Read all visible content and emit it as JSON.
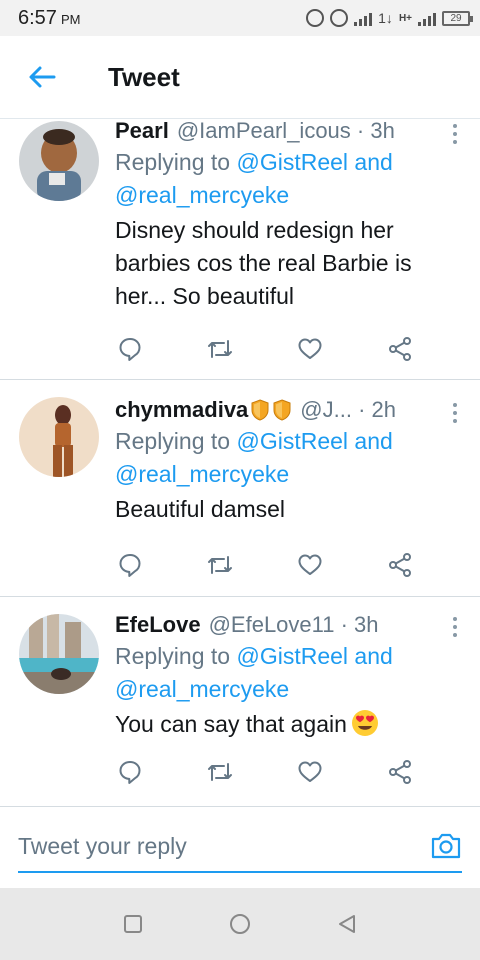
{
  "status_bar": {
    "time": "6:57",
    "ampm": "PM",
    "data_indicator": "1↓",
    "network": "H+",
    "battery": "29"
  },
  "header": {
    "title": "Tweet"
  },
  "tweets": [
    {
      "name": "Pearl",
      "handle": "@IamPearl_icous · 3h",
      "replying_prefix": "Replying to ",
      "mention_1": "@GistReel",
      "and": " and",
      "mention_2": "@real_mercyeke",
      "text": "Disney should redesign her barbies cos the real Barbie is her... So beautiful"
    },
    {
      "name": "chymmadiva",
      "handle": "@J... · 2h",
      "replying_prefix": "Replying to ",
      "mention_1": "@GistReel",
      "and": " and",
      "mention_2": "@real_mercyeke",
      "text": "Beautiful damsel"
    },
    {
      "name": "EfeLove",
      "handle": "@EfeLove11 · 3h",
      "replying_prefix": "Replying to ",
      "mention_1": "@GistReel",
      "and": " and",
      "mention_2": "@real_mercyeke",
      "text": "You can say that again"
    }
  ],
  "reply_bar": {
    "placeholder": "Tweet your reply"
  },
  "colors": {
    "accent": "#1d9bf0",
    "muted": "#657786",
    "text": "#14171a"
  }
}
